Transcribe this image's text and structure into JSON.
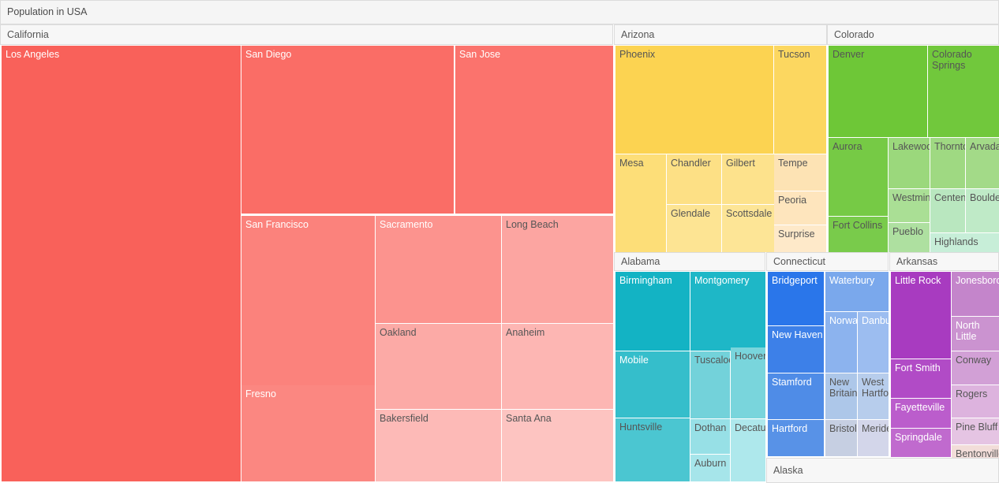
{
  "header": {
    "title": "Population in USA"
  },
  "colors": {
    "panel_bg": "#f5f5f5",
    "panel_border": "#dcdcdc",
    "label_dark": "#555555",
    "label_light": "#ffffff",
    "california_base": "#f9615a",
    "arizona_base": "#fcd351",
    "colorado_base": "#6ec737",
    "alabama_base": "#13b3c4",
    "connecticut_base": "#2a76ea",
    "arkansas_base": "#a83bc0"
  },
  "chart_data": {
    "type": "treemap",
    "title": "Population in USA",
    "groups": [
      {
        "name": "California",
        "color": "#f9615a",
        "cities": [
          {
            "label": "Los Angeles",
            "color": "#f9615a",
            "text": "light"
          },
          {
            "label": "San Diego",
            "color": "#fa6d66",
            "text": "light"
          },
          {
            "label": "San Jose",
            "color": "#fb736d",
            "text": "light"
          },
          {
            "label": "San Francisco",
            "color": "#fb827c",
            "text": "light"
          },
          {
            "label": "Fresno",
            "color": "#fb8781",
            "text": "light"
          },
          {
            "label": "Sacramento",
            "color": "#fc938e",
            "text": "light"
          },
          {
            "label": "Long Beach",
            "color": "#fca5a1",
            "text": "dark"
          },
          {
            "label": "Oakland",
            "color": "#fcaaa6",
            "text": "dark"
          },
          {
            "label": "Anaheim",
            "color": "#fdb6b3",
            "text": "dark"
          },
          {
            "label": "Bakersfield",
            "color": "#fdbab7",
            "text": "dark"
          },
          {
            "label": "Santa Ana",
            "color": "#fdc4c1",
            "text": "dark"
          }
        ]
      },
      {
        "name": "Arizona",
        "color": "#fcd351",
        "cities": [
          {
            "label": "Phoenix",
            "color": "#fcd351",
            "text": "dark"
          },
          {
            "label": "Tucson",
            "color": "#fcd760",
            "text": "dark"
          },
          {
            "label": "Mesa",
            "color": "#fdde78",
            "text": "dark"
          },
          {
            "label": "Chandler",
            "color": "#fde085",
            "text": "dark"
          },
          {
            "label": "Gilbert",
            "color": "#fde28c",
            "text": "dark"
          },
          {
            "label": "Glendale",
            "color": "#fde493",
            "text": "dark"
          },
          {
            "label": "Scottsdale",
            "color": "#fde596",
            "text": "dark"
          },
          {
            "label": "Tempe",
            "color": "#fde3b4",
            "text": "dark"
          },
          {
            "label": "Peoria",
            "color": "#fee5bd",
            "text": "dark"
          },
          {
            "label": "Surprise",
            "color": "#fee9c9",
            "text": "dark"
          }
        ]
      },
      {
        "name": "Colorado",
        "color": "#6ec737",
        "cities": [
          {
            "label": "Denver",
            "color": "#6ec737",
            "text": "dark"
          },
          {
            "label": "Colorado Springs",
            "color": "#71c83c",
            "text": "dark"
          },
          {
            "label": "Aurora",
            "color": "#76ca45",
            "text": "dark"
          },
          {
            "label": "Fort Collins",
            "color": "#79cb4b",
            "text": "dark"
          },
          {
            "label": "Lakewood",
            "color": "#9bd87c",
            "text": "dark"
          },
          {
            "label": "Thornton",
            "color": "#9fd982",
            "text": "dark"
          },
          {
            "label": "Arvada",
            "color": "#a3da88",
            "text": "dark"
          },
          {
            "label": "Westminster",
            "color": "#aadf95",
            "text": "dark"
          },
          {
            "label": "Pueblo",
            "color": "#aee0a0",
            "text": "dark"
          },
          {
            "label": "Centennial",
            "color": "#b9e7bf",
            "text": "dark"
          },
          {
            "label": "Boulder",
            "color": "#bfeac7",
            "text": "dark"
          },
          {
            "label": "Highlands",
            "color": "#c7eed8",
            "text": "dark"
          }
        ]
      },
      {
        "name": "Alabama",
        "color": "#13b3c4",
        "cities": [
          {
            "label": "Birmingham",
            "color": "#13b3c4",
            "text": "light"
          },
          {
            "label": "Montgomery",
            "color": "#1eb7c7",
            "text": "light"
          },
          {
            "label": "Mobile",
            "color": "#35becb",
            "text": "light"
          },
          {
            "label": "Huntsville",
            "color": "#4bc6d1",
            "text": "dark"
          },
          {
            "label": "Tuscaloosa",
            "color": "#73d2da",
            "text": "dark"
          },
          {
            "label": "Hoover",
            "color": "#79d5dc",
            "text": "dark"
          },
          {
            "label": "Dothan",
            "color": "#97e0e6",
            "text": "dark"
          },
          {
            "label": "Decatur",
            "color": "#aee8ec",
            "text": "dark"
          },
          {
            "label": "Auburn",
            "color": "#a6e5ea",
            "text": "dark"
          }
        ]
      },
      {
        "name": "Connecticut",
        "color": "#2a76ea",
        "cities": [
          {
            "label": "Bridgeport",
            "color": "#2a76ea",
            "text": "light"
          },
          {
            "label": "New Haven",
            "color": "#3d80e8",
            "text": "light"
          },
          {
            "label": "Stamford",
            "color": "#4f8ce7",
            "text": "light"
          },
          {
            "label": "Hartford",
            "color": "#5892e7",
            "text": "light"
          },
          {
            "label": "Waterbury",
            "color": "#7aa8ec",
            "text": "light"
          },
          {
            "label": "Norwalk",
            "color": "#8cb3ee",
            "text": "light"
          },
          {
            "label": "Danbury",
            "color": "#9cbdf0",
            "text": "light"
          },
          {
            "label": "New Britain",
            "color": "#adc7e9",
            "text": "dark"
          },
          {
            "label": "West Hartford",
            "color": "#b7cdec",
            "text": "dark"
          },
          {
            "label": "Bristol",
            "color": "#c6cfe2",
            "text": "dark"
          },
          {
            "label": "Meriden",
            "color": "#d3d6ea",
            "text": "dark"
          }
        ]
      },
      {
        "name": "Arkansas",
        "color": "#a83bc0",
        "cities": [
          {
            "label": "Little Rock",
            "color": "#a83bc0",
            "text": "light"
          },
          {
            "label": "Fort Smith",
            "color": "#b14bc6",
            "text": "light"
          },
          {
            "label": "Fayetteville",
            "color": "#bb5dcc",
            "text": "light"
          },
          {
            "label": "Springdale",
            "color": "#c06ace",
            "text": "light"
          },
          {
            "label": "Jonesboro",
            "color": "#c485cb",
            "text": "light"
          },
          {
            "label": "North Little",
            "color": "#cb93d0",
            "text": "light"
          },
          {
            "label": "Conway",
            "color": "#d2a0d6",
            "text": "dark"
          },
          {
            "label": "Rogers",
            "color": "#ddb3de",
            "text": "dark"
          },
          {
            "label": "Pine Bluff",
            "color": "#e5c4e3",
            "text": "dark"
          },
          {
            "label": "Bentonville",
            "color": "#f2ddd9",
            "text": "dark"
          }
        ]
      },
      {
        "name": "Alaska",
        "color": "#aee8ec",
        "cities": []
      }
    ]
  }
}
